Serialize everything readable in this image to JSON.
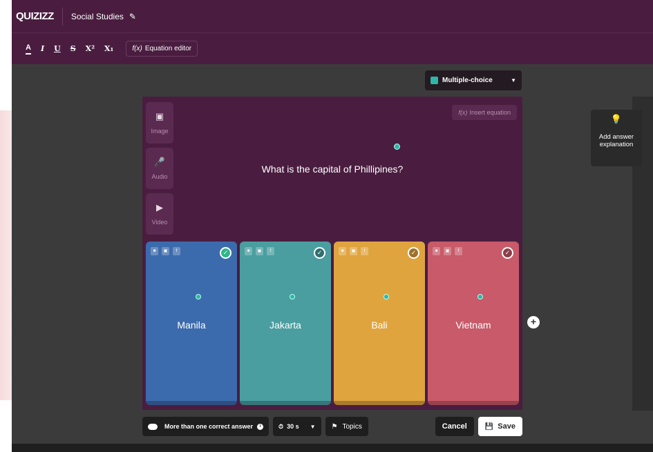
{
  "header": {
    "logo": "QUIZIZZ",
    "quiz_title": "Social Studies",
    "edit_icon": "pencil-icon"
  },
  "toolbar": {
    "bold": "A",
    "italic": "I",
    "underline": "U",
    "strike": "S",
    "superscript": "X²",
    "subscript": "X₁",
    "equation_editor": "Equation editor"
  },
  "question_type": {
    "selected": "Multiple-choice"
  },
  "media": {
    "image": "Image",
    "audio": "Audio",
    "video": "Video"
  },
  "insert_equation": "Insert equation",
  "question": {
    "text": "What is the capital of Phillipines?"
  },
  "answers": [
    {
      "label": "Manila",
      "color": "#3c6bad",
      "correct": true
    },
    {
      "label": "Jakarta",
      "color": "#4a9ea0",
      "correct": false
    },
    {
      "label": "Bali",
      "color": "#e0a43f",
      "correct": false
    },
    {
      "label": "Vietnam",
      "color": "#c85a69",
      "correct": false
    }
  ],
  "explanation": {
    "label": "Add answer explanation"
  },
  "footer": {
    "multi_correct_label": "More than one correct answer",
    "timer_value": "30 s",
    "topics_label": "Topics",
    "cancel_label": "Cancel",
    "save_label": "Save"
  }
}
